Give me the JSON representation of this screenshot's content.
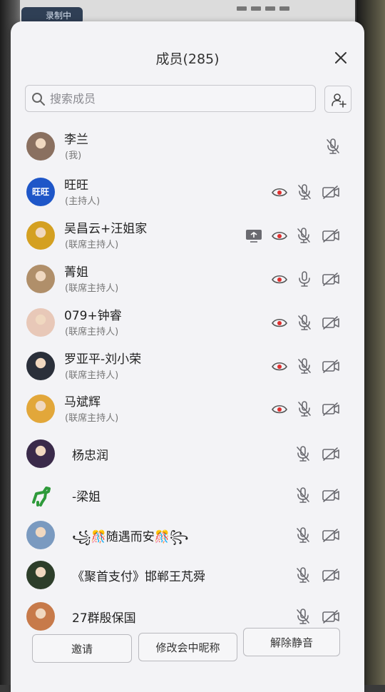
{
  "status_bar": {
    "recording_label": "录制中"
  },
  "panel": {
    "title": "成员(285)",
    "search_placeholder": "搜索成员"
  },
  "members": [
    {
      "name": "李兰",
      "role": "(我)",
      "avatar_icon": "photo-avatar",
      "avatar_color": "#8a7060",
      "icons": [
        "mic-muted-icon"
      ]
    },
    {
      "name": "旺旺",
      "role": "(主持人)",
      "avatar_text": "旺旺",
      "avatar_color": "#1e56c8",
      "icons": [
        "eye-icon",
        "mic-muted-icon",
        "camera-off-icon"
      ]
    },
    {
      "name": "吴昌云+汪姐家",
      "role": "(联席主持人)",
      "avatar_icon": "photo-avatar",
      "avatar_color": "#d4a021",
      "icons": [
        "screen-share-icon",
        "eye-icon",
        "mic-muted-icon",
        "camera-off-icon"
      ]
    },
    {
      "name": "菁姐",
      "role": "(联席主持人)",
      "avatar_icon": "photo-avatar",
      "avatar_color": "#b08f6a",
      "icons": [
        "eye-icon",
        "mic-on-icon",
        "camera-off-icon"
      ]
    },
    {
      "name": "079+钟睿",
      "role": "(联席主持人)",
      "avatar_icon": "photo-avatar",
      "avatar_color": "#e8c8b8",
      "icons": [
        "eye-icon",
        "mic-muted-icon",
        "camera-off-icon"
      ]
    },
    {
      "name": "罗亚平-刘小荣",
      "role": "(联席主持人)",
      "avatar_icon": "photo-avatar",
      "avatar_color": "#2a2f3a",
      "icons": [
        "eye-icon",
        "mic-muted-icon",
        "camera-off-icon"
      ]
    },
    {
      "name": "马斌辉",
      "role": "(联席主持人)",
      "avatar_icon": "photo-avatar",
      "avatar_color": "#e2a73a",
      "icons": [
        "eye-icon",
        "mic-muted-icon",
        "camera-off-icon"
      ]
    },
    {
      "name": "杨忠润",
      "role": "",
      "avatar_icon": "photo-avatar",
      "avatar_color": "#3a2a4a",
      "icons": [
        "mic-muted-icon",
        "camera-off-icon"
      ]
    },
    {
      "name": "-梁姐",
      "role": "",
      "avatar_icon": "dinosaur-avatar",
      "avatar_color": "#f3f3f6",
      "icons": [
        "mic-muted-icon",
        "camera-off-icon"
      ]
    },
    {
      "name": "꧁🎊随遇而安🎊꧂",
      "role": "",
      "avatar_icon": "photo-avatar",
      "avatar_color": "#7a9ac0",
      "icons": [
        "mic-muted-icon",
        "camera-off-icon"
      ]
    },
    {
      "name": "《聚首支付》邯郸王芃舜",
      "role": "",
      "avatar_icon": "photo-avatar",
      "avatar_color": "#2d3e2a",
      "icons": [
        "mic-muted-icon",
        "camera-off-icon"
      ]
    },
    {
      "name": "27群殷保国",
      "role": "",
      "avatar_icon": "photo-avatar",
      "avatar_color": "#c77a4a",
      "icons": [
        "mic-muted-icon",
        "camera-off-icon"
      ]
    }
  ],
  "buttons": {
    "invite": "邀请",
    "rename": "修改会中昵称",
    "unmute": "解除静音"
  },
  "colors": {
    "eye_red": "#e0302f",
    "icon_gray": "#6a6a70",
    "sheet_bg": "#f3f3f6"
  }
}
